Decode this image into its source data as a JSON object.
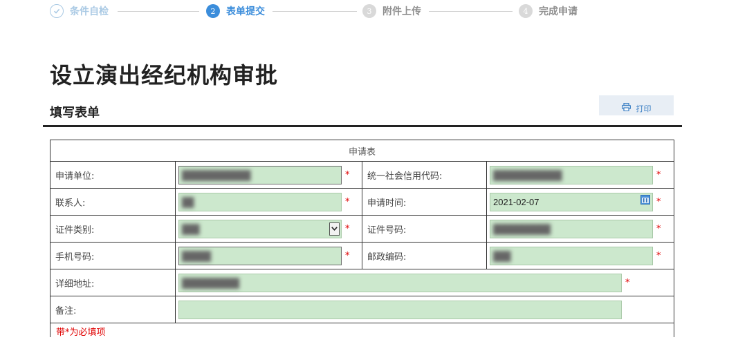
{
  "steps": [
    {
      "num": "✓",
      "label": "条件自检"
    },
    {
      "num": "2",
      "label": "表单提交"
    },
    {
      "num": "3",
      "label": "附件上传"
    },
    {
      "num": "4",
      "label": "完成申请"
    }
  ],
  "page_title": "设立演出经纪机构审批",
  "section_title": "填写表单",
  "print_label": "打印",
  "form": {
    "caption": "申请表",
    "required_mark": "*",
    "applicant_unit_label": "申请单位:",
    "applicant_unit_value": "████████████",
    "credit_code_label": "统一社会信用代码:",
    "credit_code_value": "████████████",
    "contact_label": "联系人:",
    "contact_value": "██",
    "apply_time_label": "申请时间:",
    "apply_time_value": "2021-02-07",
    "id_type_label": "证件类别:",
    "id_type_value": "███",
    "id_number_label": "证件号码:",
    "id_number_value": "██████████",
    "phone_label": "手机号码:",
    "phone_value": "█████",
    "postal_label": "邮政编码:",
    "postal_value": "███",
    "address_label": "详细地址:",
    "address_value": "██████████",
    "remark_label": "备注:",
    "remark_value": "",
    "footnote": "带*为必填项"
  },
  "colors": {
    "accent": "#3b8ddb",
    "field_bg": "#cce8cd",
    "required": "#e00000"
  }
}
